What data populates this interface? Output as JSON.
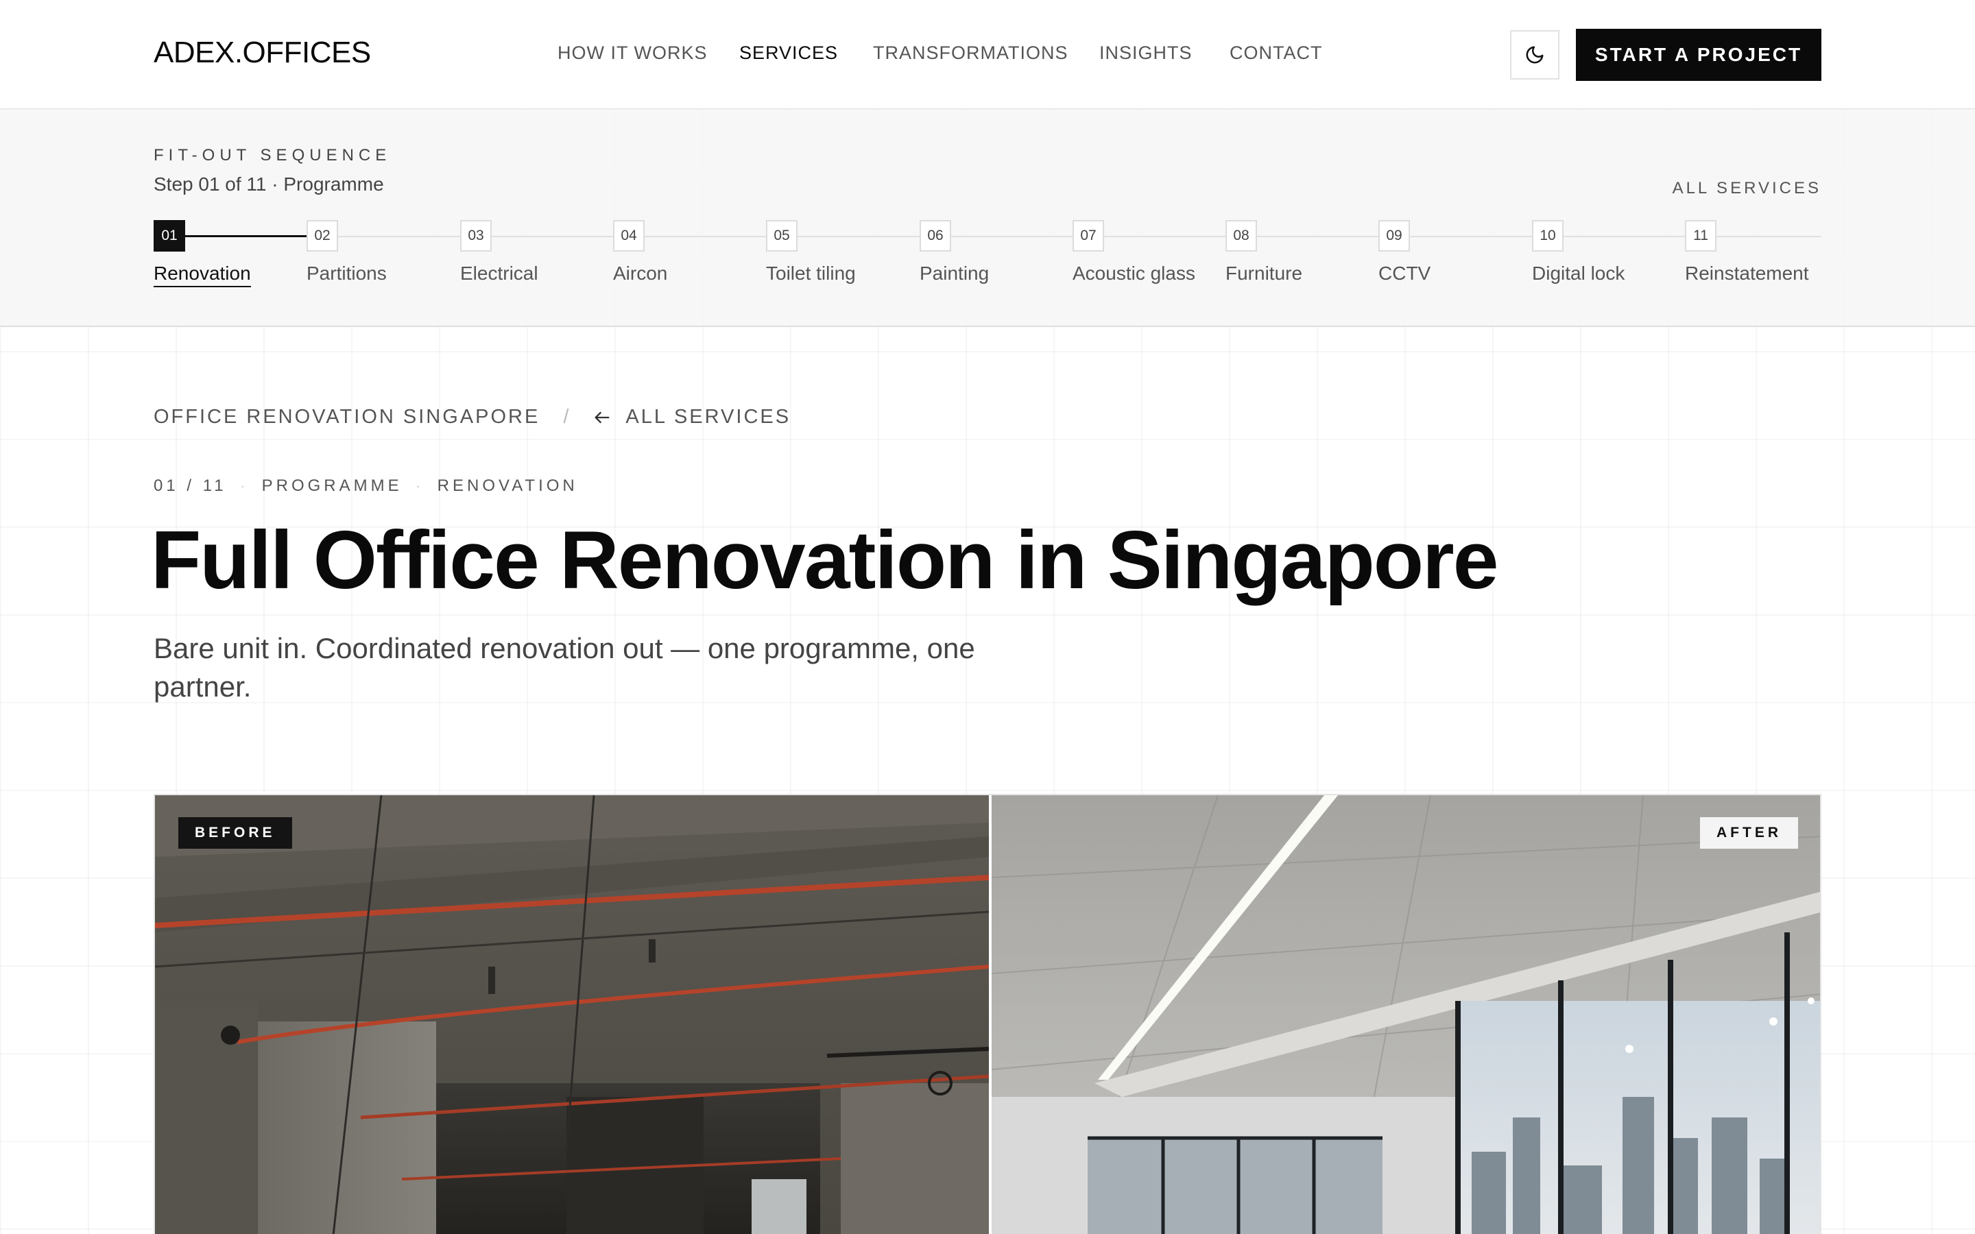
{
  "header": {
    "logo": "ADEX.OFFICES",
    "nav": [
      {
        "label": "HOW IT WORKS",
        "active": false
      },
      {
        "label": "SERVICES",
        "active": true
      },
      {
        "label": "TRANSFORMATIONS",
        "active": false
      },
      {
        "label": "INSIGHTS",
        "active": false
      },
      {
        "label": "CONTACT",
        "active": false
      }
    ],
    "theme_toggle_icon": "moon-icon",
    "cta_label": "START A PROJECT"
  },
  "sequence": {
    "eyebrow": "FIT-OUT SEQUENCE",
    "step_text": "Step 01 of 11 · Programme",
    "all_services_label": "ALL SERVICES",
    "current_step": 1,
    "steps": [
      {
        "num": "01",
        "label": "Renovation"
      },
      {
        "num": "02",
        "label": "Partitions"
      },
      {
        "num": "03",
        "label": "Electrical"
      },
      {
        "num": "04",
        "label": "Aircon"
      },
      {
        "num": "05",
        "label": "Toilet tiling"
      },
      {
        "num": "06",
        "label": "Painting"
      },
      {
        "num": "07",
        "label": "Acoustic glass"
      },
      {
        "num": "08",
        "label": "Furniture"
      },
      {
        "num": "09",
        "label": "CCTV"
      },
      {
        "num": "10",
        "label": "Digital lock"
      },
      {
        "num": "11",
        "label": "Reinstatement"
      }
    ]
  },
  "breadcrumb": {
    "current": "OFFICE RENOVATION SINGAPORE",
    "separator": "/",
    "back_label": "ALL SERVICES",
    "back_icon": "arrow-left-icon"
  },
  "meta": {
    "index": "01 / 11",
    "category": "PROGRAMME",
    "service": "RENOVATION"
  },
  "hero": {
    "title": "Full Office Renovation in Singapore",
    "subtitle": "Bare unit in. Coordinated renovation out — one programme, one partner."
  },
  "compare": {
    "before_label": "BEFORE",
    "after_label": "AFTER"
  },
  "colors": {
    "ink": "#0a0a0a",
    "muted": "#555555",
    "accent_pipe": "#b5432a",
    "band": "#f6f6f6"
  }
}
